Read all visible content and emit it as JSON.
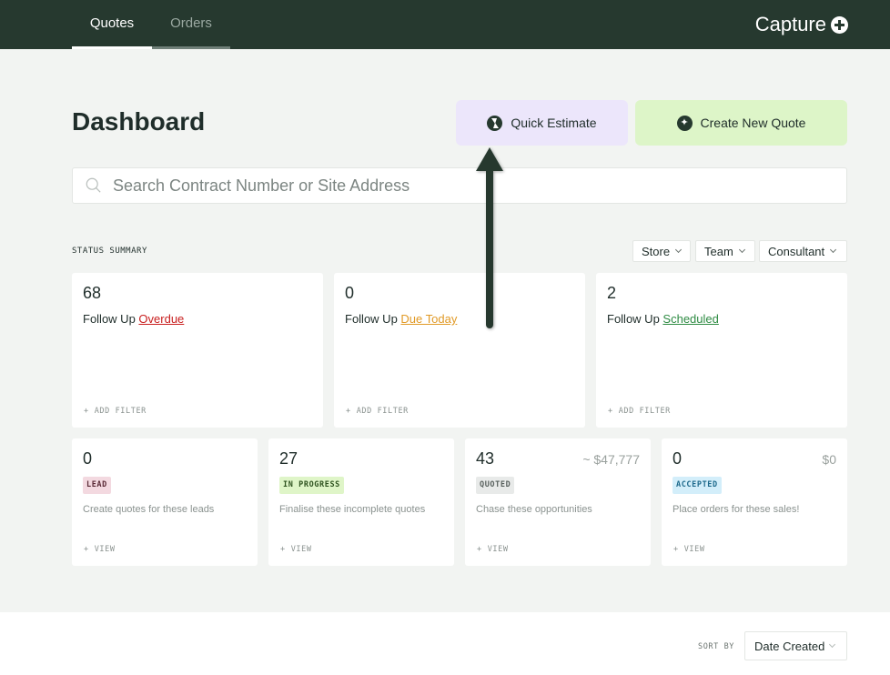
{
  "nav": {
    "tabs": [
      {
        "label": "Quotes",
        "active": true
      },
      {
        "label": "Orders",
        "active": false
      }
    ],
    "brand": "Capture"
  },
  "page": {
    "title": "Dashboard"
  },
  "actions": {
    "quick_estimate": "Quick Estimate",
    "create_quote": "Create New Quote"
  },
  "search": {
    "placeholder": "Search Contract Number or Site Address"
  },
  "status_summary": {
    "label": "STATUS SUMMARY",
    "filters": [
      "Store",
      "Team",
      "Consultant"
    ]
  },
  "follow_ups": [
    {
      "count": "68",
      "prefix": "Follow Up",
      "status": "Overdue",
      "action": "ADD FILTER"
    },
    {
      "count": "0",
      "prefix": "Follow Up",
      "status": "Due Today",
      "action": "ADD FILTER"
    },
    {
      "count": "2",
      "prefix": "Follow Up",
      "status": "Scheduled",
      "action": "ADD FILTER"
    }
  ],
  "stages": [
    {
      "count": "0",
      "badge": "LEAD",
      "description": "Create quotes for these leads",
      "amount": "",
      "action": "VIEW"
    },
    {
      "count": "27",
      "badge": "IN PROGRESS",
      "description": "Finalise these incomplete quotes",
      "amount": "",
      "action": "VIEW"
    },
    {
      "count": "43",
      "badge": "QUOTED",
      "description": "Chase these opportunities",
      "amount": "~ $47,777",
      "action": "VIEW"
    },
    {
      "count": "0",
      "badge": "ACCEPTED",
      "description": "Place orders for these sales!",
      "amount": "$0",
      "action": "VIEW"
    }
  ],
  "sort": {
    "label": "SORT BY",
    "value": "Date Created"
  },
  "colors": {
    "nav_bg": "#26392f",
    "quick_estimate_bg": "#ece6fb",
    "create_quote_bg": "#ddf5c8",
    "overdue": "#c81e1e",
    "due_today": "#e19a26",
    "scheduled": "#2e8b43",
    "badge_lead": "#f3d9e0",
    "badge_in_progress": "#dff5c8",
    "badge_quoted": "#e8eae9",
    "badge_accepted": "#d3eefa",
    "annotation_arrow": "#26392f"
  },
  "icons": {
    "brand": "plus-circle-icon",
    "quick_estimate": "bolt-icon",
    "create_quote": "sparkle-icon",
    "search": "search-icon"
  }
}
